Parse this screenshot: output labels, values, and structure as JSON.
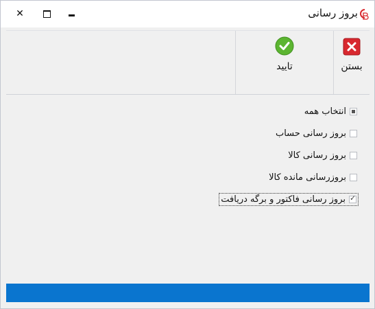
{
  "window": {
    "title": "بروز رسانی",
    "controls": {
      "close": "✕",
      "maximize": "☐",
      "minimize": "▬"
    },
    "logo_icon": "gb-logo-icon"
  },
  "toolbar": {
    "close_label": "بستن",
    "confirm_label": "تایید",
    "close_icon": "close-red-icon",
    "confirm_icon": "check-green-icon"
  },
  "options": [
    {
      "label": "انتخاب همه",
      "state": "indeterminate"
    },
    {
      "label": "بروز رسانی حساب",
      "state": "unchecked"
    },
    {
      "label": "بروز رسانی کالا",
      "state": "unchecked"
    },
    {
      "label": "بروزرسانی مانده کالا",
      "state": "unchecked"
    },
    {
      "label": "بروز رسانی فاکتور و برگه دریافت",
      "state": "checked"
    }
  ],
  "colors": {
    "status_bar": "#0a75cf",
    "close_red": "#d8282f",
    "confirm_green": "#5cb531"
  }
}
